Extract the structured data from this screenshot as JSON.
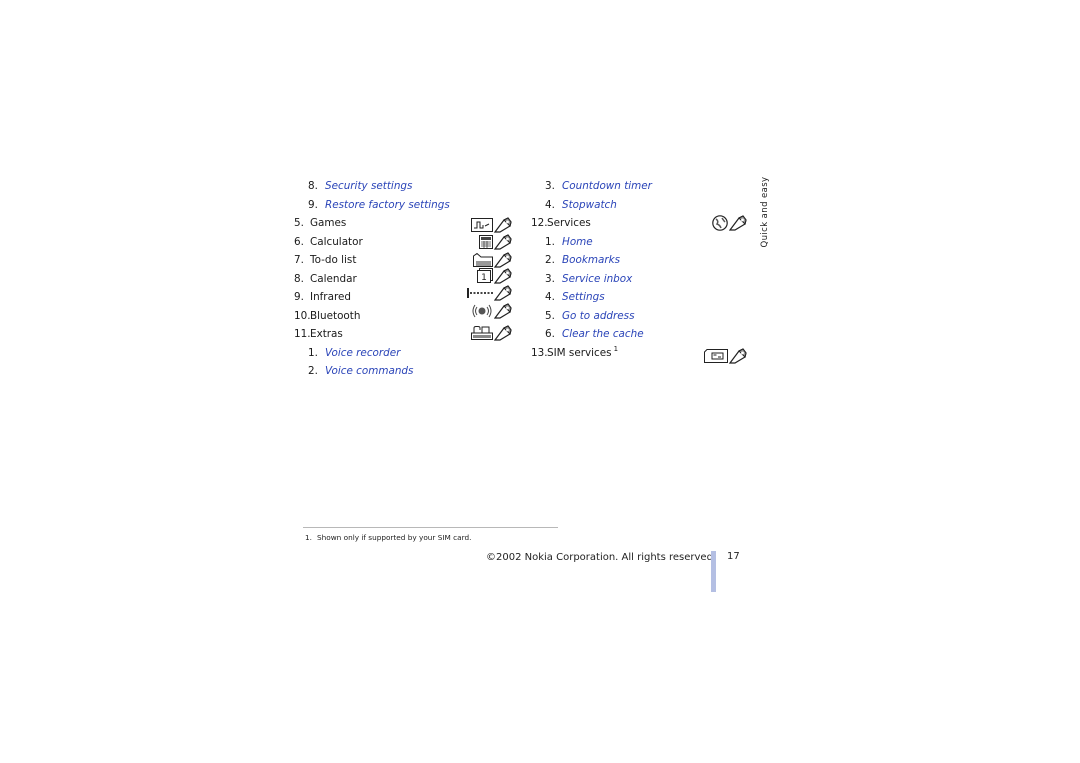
{
  "left_column": [
    {
      "level": 2,
      "num": "8.",
      "label": "Security settings"
    },
    {
      "level": 2,
      "num": "9.",
      "label": "Restore factory settings"
    },
    {
      "level": 1,
      "num": "5.",
      "label": "Games",
      "icon": "games-icon"
    },
    {
      "level": 1,
      "num": "6.",
      "label": "Calculator",
      "icon": "calculator-icon"
    },
    {
      "level": 1,
      "num": "7.",
      "label": "To-do list",
      "icon": "todo-list-icon"
    },
    {
      "level": 1,
      "num": "8.",
      "label": "Calendar",
      "icon": "calendar-icon"
    },
    {
      "level": 1,
      "num": "9.",
      "label": "Infrared",
      "icon": "infrared-icon"
    },
    {
      "level": 1,
      "num": "10.",
      "label": "Bluetooth",
      "icon": "bluetooth-icon"
    },
    {
      "level": 1,
      "num": "11.",
      "label": "Extras",
      "icon": "extras-icon"
    },
    {
      "level": 2,
      "num": "1.",
      "label": "Voice recorder"
    },
    {
      "level": 2,
      "num": "2.",
      "label": "Voice commands"
    }
  ],
  "right_column": [
    {
      "level": 2,
      "num": "3.",
      "label": "Countdown timer"
    },
    {
      "level": 2,
      "num": "4.",
      "label": "Stopwatch"
    },
    {
      "level": 1,
      "num": "12.",
      "label": "Services",
      "icon": "services-globe-icon"
    },
    {
      "level": 2,
      "num": "1.",
      "label": "Home"
    },
    {
      "level": 2,
      "num": "2.",
      "label": "Bookmarks"
    },
    {
      "level": 2,
      "num": "3.",
      "label": "Service inbox"
    },
    {
      "level": 2,
      "num": "4.",
      "label": "Settings"
    },
    {
      "level": 2,
      "num": "5.",
      "label": "Go to address"
    },
    {
      "level": 2,
      "num": "6.",
      "label": "Clear the cache"
    },
    {
      "level": 1,
      "num": "13.",
      "label": "SIM services",
      "sup": "1",
      "icon": "sim-card-icon"
    }
  ],
  "side_tab": "Quick and easy",
  "footnote": {
    "num": "1.",
    "text": "Shown only if supported by your SIM card."
  },
  "copyright": "©2002 Nokia Corporation. All rights reserved.",
  "page_number": "17",
  "colors": {
    "link": "#2a44b8",
    "page_bar": "#b4bfe3"
  }
}
